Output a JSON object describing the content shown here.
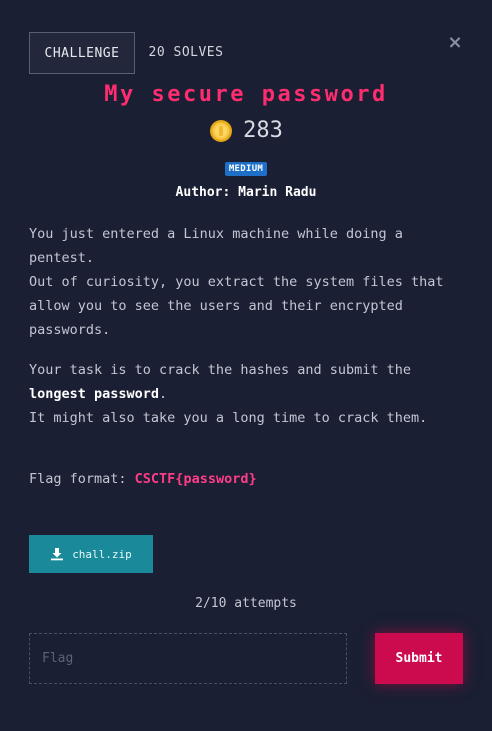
{
  "tabs": {
    "challenge": "CHALLENGE",
    "solves": "20 SOLVES"
  },
  "close_icon": "×",
  "challenge": {
    "title": "My secure password",
    "points": "283",
    "difficulty": "MEDIUM",
    "author": "Author: Marin Radu"
  },
  "description": {
    "p1_lines": [
      "You just entered a Linux machine while doing a",
      "pentest.",
      "Out of curiosity, you extract the system files that",
      "allow you to see the users and their encrypted",
      "passwords."
    ],
    "p2_line1": "Your task is to crack the hashes and submit the",
    "p2_bold": "longest password",
    "p2_after_bold": ".",
    "p2_line3": "It might also take you a long time to crack them."
  },
  "flag_format": {
    "label": "Flag format: ",
    "value": "CSCTF{password}"
  },
  "download": {
    "label": "chall.zip",
    "icon": "download-icon"
  },
  "attempts": "2/10 attempts",
  "form": {
    "placeholder": "Flag",
    "value": "",
    "submit_label": "Submit"
  },
  "colors": {
    "background": "#1a1f33",
    "title": "#ff2d6f",
    "badge": "#1e6fc8",
    "download": "#1a8a9a",
    "submit": "#cc0a4e",
    "flag_code": "#ff3d86"
  }
}
